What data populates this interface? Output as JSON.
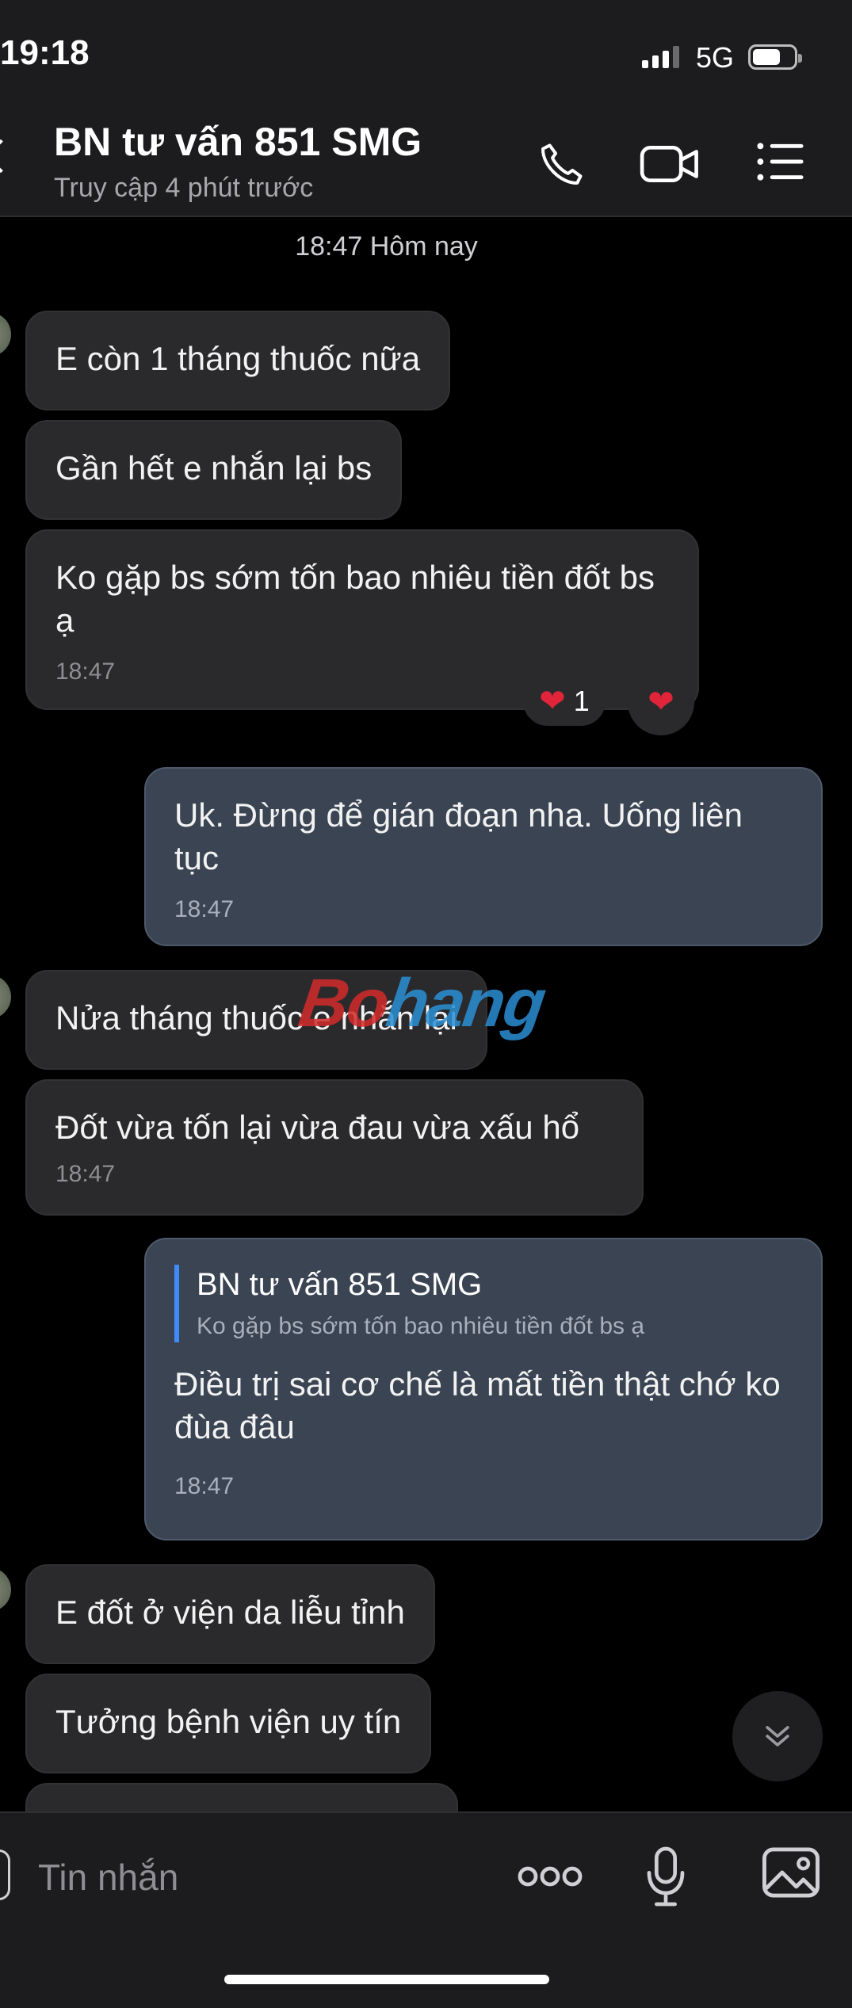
{
  "status": {
    "time": "19:18",
    "network": "5G"
  },
  "header": {
    "title": "BN tư vấn 851 SMG",
    "subtitle": "Truy cập 4 phút trước",
    "icons": [
      "back-icon",
      "phone-icon",
      "video-icon",
      "menu-list-icon"
    ]
  },
  "chat": {
    "date_label": "18:47 Hôm nay",
    "messages": [
      {
        "dir": "in",
        "text": "E còn 1 tháng thuốc nữa"
      },
      {
        "dir": "in",
        "text": "Gần hết e nhắn lại bs"
      },
      {
        "dir": "in",
        "text": "Ko gặp bs sớm tốn bao nhiêu tiền đốt bs ạ",
        "time": "18:47",
        "reaction_count": "1"
      },
      {
        "dir": "out",
        "text": "Uk. Đừng để gián đoạn nha. Uống liên tục",
        "time": "18:47"
      },
      {
        "dir": "in",
        "text": "Nửa tháng thuốc e nhắn lại"
      },
      {
        "dir": "in",
        "text": "Đốt vừa tốn lại vừa đau vừa xấu hổ",
        "time": "18:47"
      },
      {
        "dir": "out",
        "quote_name": "BN tư vấn 851 SMG",
        "quote_text": "Ko gặp bs sớm tốn bao nhiêu tiền đốt bs ạ",
        "text": "Điều trị sai cơ chế là mất tiền thật chớ ko đùa đâu",
        "time": "18:47"
      },
      {
        "dir": "in",
        "text": "E đốt ở viện da liễu tỉnh"
      },
      {
        "dir": "in",
        "text": "Tưởng bệnh viện uy tín"
      }
    ],
    "watermark_part1": "Bo",
    "watermark_part2": "hang"
  },
  "composer": {
    "placeholder": "Tin nhắn",
    "icons": [
      "more-icon",
      "microphone-icon",
      "image-icon"
    ]
  },
  "colors": {
    "background": "#000000",
    "incoming": "#2a2a2c",
    "outgoing": "#3a4452",
    "accent": "#3d8bff",
    "heart": "#e0243a"
  }
}
